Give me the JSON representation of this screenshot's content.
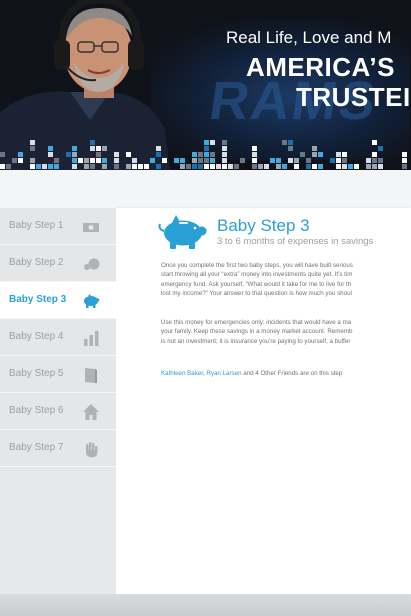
{
  "hero": {
    "tagline": "Real Life, Love and M",
    "title_line1": "AMERICA’S",
    "title_line2": "TRUSTEI",
    "background_word": "RAMS"
  },
  "sidebar": {
    "items": [
      {
        "label": "Baby Step 1",
        "icon": "money-bill-icon",
        "active": false
      },
      {
        "label": "Baby Step 2",
        "icon": "debt-snowball-icon",
        "active": false
      },
      {
        "label": "Baby Step 3",
        "icon": "piggy-bank-icon",
        "active": true
      },
      {
        "label": "Baby Step 4",
        "icon": "bar-chart-icon",
        "active": false
      },
      {
        "label": "Baby Step 5",
        "icon": "book-icon",
        "active": false
      },
      {
        "label": "Baby Step 6",
        "icon": "house-icon",
        "active": false
      },
      {
        "label": "Baby Step 7",
        "icon": "hand-icon",
        "active": false
      }
    ]
  },
  "content": {
    "title": "Baby Step 3",
    "subtitle": "3 to 6 months of expenses in savings",
    "paragraph1": [
      "Once you complete the first two baby steps, you will have built serious",
      "start throwing all your “extra” money into investments quite yet. It’s tim",
      "emergency fund. Ask yourself, “What would it take for me to live for th",
      "lost my income?” Your answer to that question is how much you shoul"
    ],
    "paragraph2": [
      "Use this money for emergencies only: incidents that would have a ma",
      "your family. Keep these savings in a money market account. Rememb",
      "is not an investment; it is insurance you’re paying to yourself, a buffer"
    ],
    "friends": {
      "name1": "Kathleen Baker",
      "separator": ", ",
      "name2": "Ryan Larsen",
      "rest": " and 4 Other Friends are on this step"
    }
  },
  "colors": {
    "accent": "#2aa1d6",
    "sidebar_bg": "#e5e6e8",
    "text_muted": "#9aa0a6",
    "hero_bg": "#0f1218"
  }
}
